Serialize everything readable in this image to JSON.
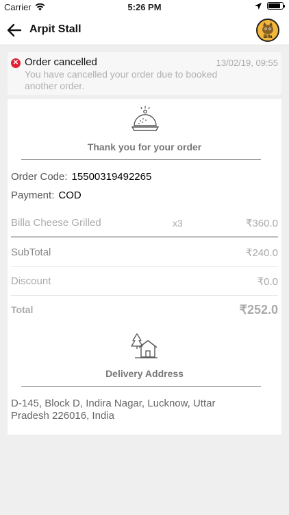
{
  "statusbar": {
    "carrier": "Carrier",
    "time": "5:26 PM",
    "battery_level": 0.85
  },
  "navbar": {
    "title": "Arpit Stall",
    "avatar_label": "Billa"
  },
  "notice": {
    "title": "Order cancelled",
    "date": "13/02/19, 09:55",
    "message": "You have cancelled your order due to booked another order.",
    "status_color": "#e21f34"
  },
  "order": {
    "thank_you": "Thank you for your order",
    "code_label": "Order Code:",
    "code_value": "15500319492265",
    "payment_label": "Payment:",
    "payment_value": "COD"
  },
  "items": [
    {
      "name": "Billa Cheese Grilled",
      "qty": "x3",
      "price": "₹360.0"
    }
  ],
  "summary": {
    "subtotal_label": "SubTotal",
    "subtotal_value": "₹240.0",
    "discount_label": "Discount",
    "discount_value": "₹0.0",
    "total_label": "Total",
    "total_value": "₹252.0"
  },
  "delivery": {
    "heading": "Delivery Address",
    "address": "D-145, Block D, Indira Nagar, Lucknow, Uttar Pradesh 226016, India"
  },
  "icons": {
    "back": "arrow-left-icon",
    "wifi": "wifi-icon",
    "location": "location-arrow-icon",
    "battery": "battery-icon",
    "plate": "cloche-icon",
    "house": "house-icon",
    "cancel": "cancel-x-icon"
  }
}
